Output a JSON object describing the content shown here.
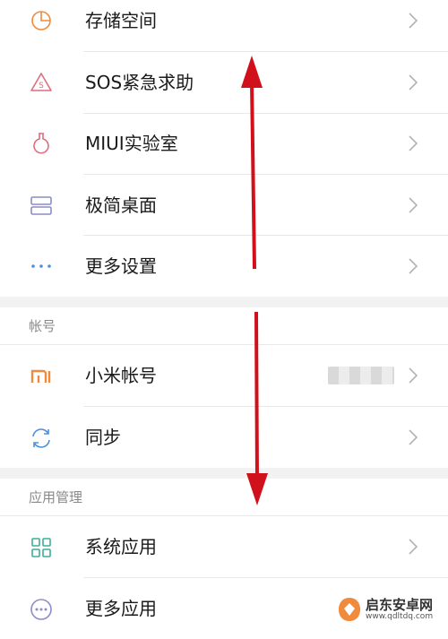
{
  "settings": {
    "items_top": [
      {
        "label": "存储空间",
        "icon": "pie-chart-icon"
      },
      {
        "label": "SOS紧急求助",
        "icon": "sos-icon"
      },
      {
        "label": "MIUI实验室",
        "icon": "flask-icon"
      },
      {
        "label": "极简桌面",
        "icon": "simple-desktop-icon"
      },
      {
        "label": "更多设置",
        "icon": "more-dots-icon"
      }
    ],
    "section_account": {
      "title": "帐号",
      "items": [
        {
          "label": "小米帐号",
          "icon": "mi-logo-icon"
        },
        {
          "label": "同步",
          "icon": "sync-icon"
        }
      ]
    },
    "section_apps": {
      "title": "应用管理",
      "items": [
        {
          "label": "系统应用",
          "icon": "grid-apps-icon"
        },
        {
          "label": "更多应用",
          "icon": "more-apps-icon"
        }
      ]
    }
  },
  "watermark": {
    "text": "启东安卓网",
    "url": "www.qdltdq.com"
  },
  "colors": {
    "arrow": "#d0111b",
    "chevron": "#b3b3b3",
    "orange": "#f08a3c",
    "blue": "#4a90e2",
    "purple": "#8c8cc8",
    "pink": "#e06d7e",
    "teal": "#3cae9b"
  }
}
